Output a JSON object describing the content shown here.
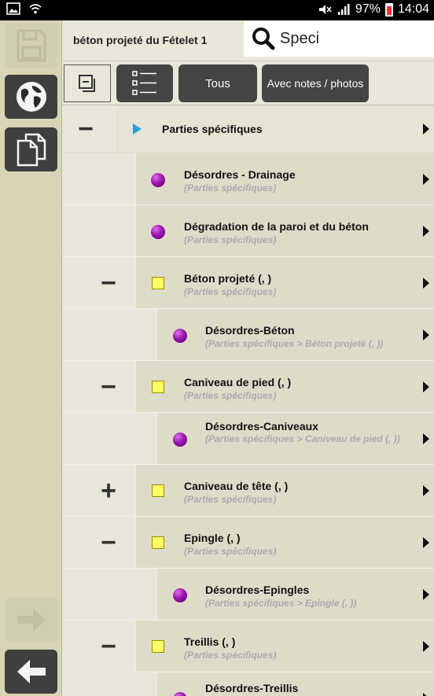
{
  "status_bar": {
    "battery": "97%",
    "time": "14:04"
  },
  "header": {
    "title": "béton projeté du Fételet 1",
    "search_value": "Speci"
  },
  "toolbar": {
    "all_label": "Tous",
    "notes_label": "Avec notes / photos"
  },
  "tree": {
    "root": {
      "toggle": "−",
      "label": "Parties spécifiques"
    },
    "rows": [
      {
        "label": "Désordres - Drainage",
        "path": "(Parties spécifiques)"
      },
      {
        "label": "Dégradation de la paroi et du béton",
        "path": "(Parties spécifiques)"
      },
      {
        "toggle": "−",
        "label": "Béton projeté (, )",
        "path": "(Parties spécifiques)"
      },
      {
        "label": "Désordres-Béton",
        "path": "(Parties spécifiques > Béton projeté (, ))"
      },
      {
        "toggle": "−",
        "label": "Caniveau de pied (, )",
        "path": "(Parties spécifiques)"
      },
      {
        "label": "Désordres-Caniveaux",
        "path": "(Parties spécifiques > Caniveau de pied (, ))"
      },
      {
        "toggle": "+",
        "label": "Caniveau de tête (, )",
        "path": "(Parties spécifiques)"
      },
      {
        "toggle": "−",
        "label": "Epingle (, )",
        "path": "(Parties spécifiques)"
      },
      {
        "label": "Désordres-Epingles",
        "path": "(Parties spécifiques > Epingle (, ))"
      },
      {
        "toggle": "−",
        "label": "Treillis (, )",
        "path": "(Parties spécifiques)"
      },
      {
        "label": "Désordres-Treillis"
      }
    ]
  },
  "colors": {
    "rail": "#d7d5b6",
    "background": "#e8e7da",
    "cell": "#dedcc8",
    "button_dark": "#444444",
    "defect_dot": "#9a15b0",
    "component_square": "#ffff66",
    "root_triangle": "#2a9de0"
  }
}
